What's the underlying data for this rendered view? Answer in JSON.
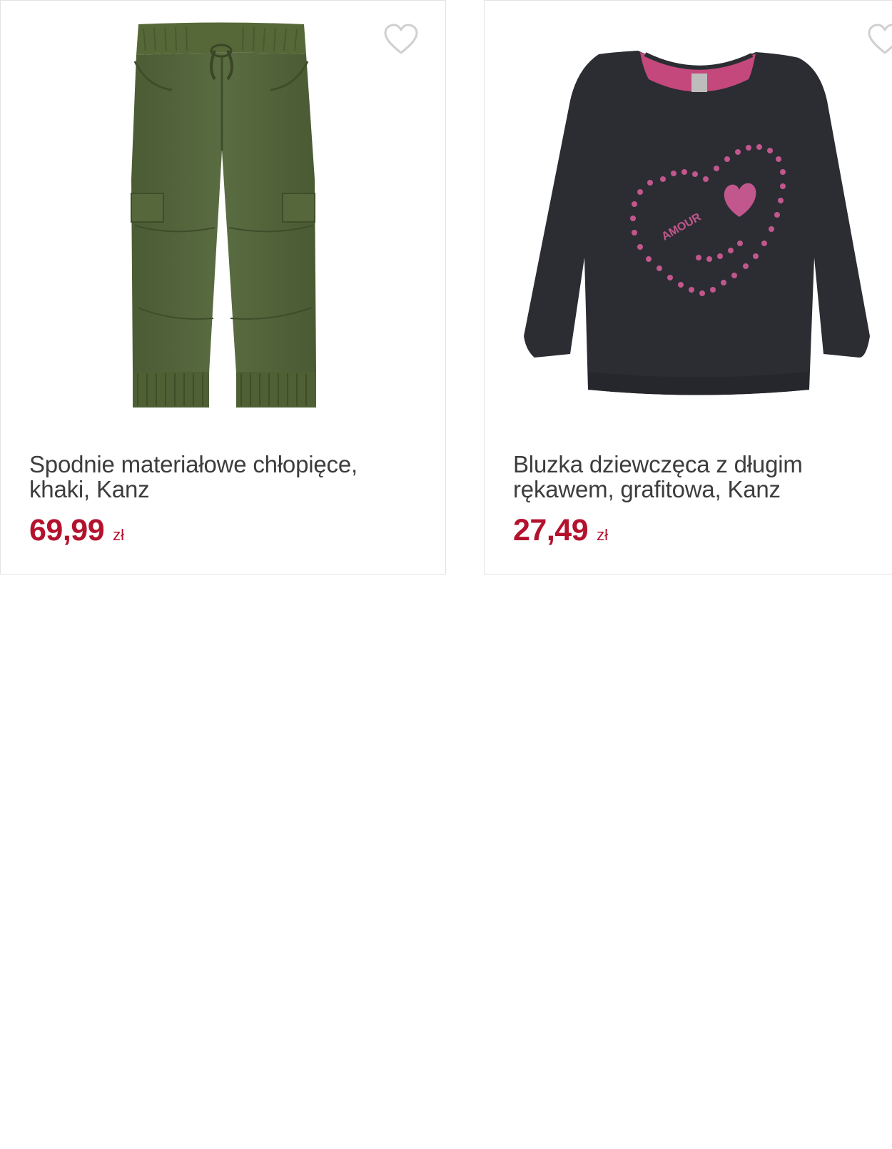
{
  "colors": {
    "price": "#b3122d",
    "title": "#3d3d3d",
    "border": "#e3e3e3",
    "heart": "#d0d0d0"
  },
  "products": [
    {
      "title": "Spodnie materiałowe chłopięce, khaki, Kanz",
      "price": "69,99",
      "currency": "zł",
      "image": "khaki-cargo-jogger-pants",
      "favorite_icon": "heart-outline-icon"
    },
    {
      "title": "Bluzka dziewczęca z długim rękawem, grafitowa, Kanz",
      "price": "27,49",
      "currency": "zł",
      "image": "graphite-long-sleeve-top-pink-heart-print",
      "favorite_icon": "heart-outline-icon"
    }
  ]
}
